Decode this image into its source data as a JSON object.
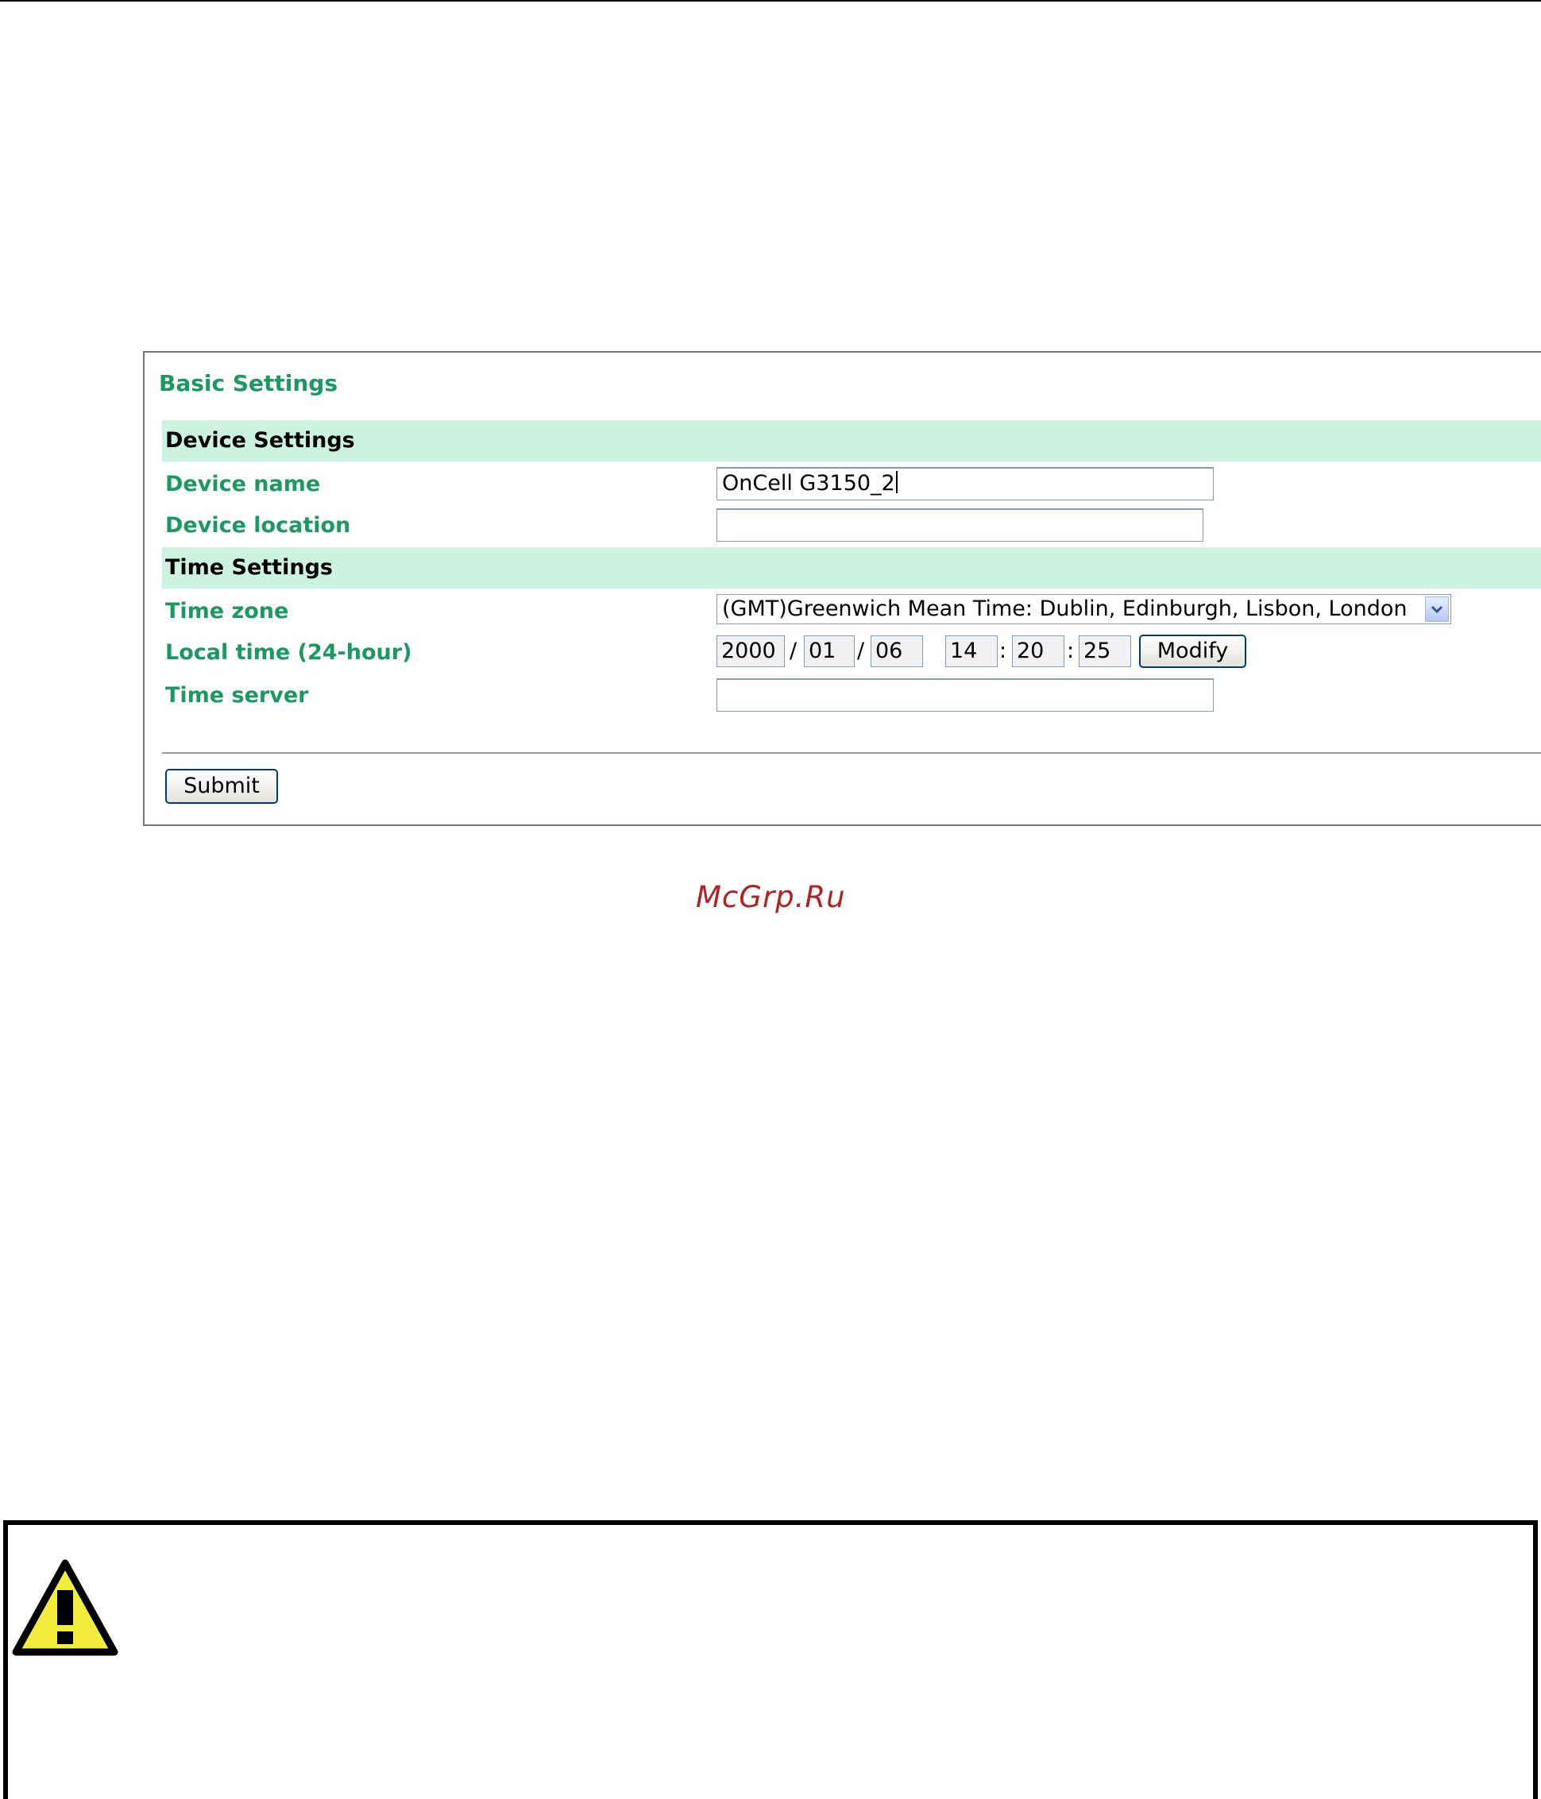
{
  "panel": {
    "title": "Basic Settings",
    "device_section": "Device Settings",
    "device_name_label": "Device name",
    "device_name_value": "OnCell G3150_2",
    "device_location_label": "Device location",
    "device_location_value": "",
    "time_section": "Time Settings",
    "time_zone_label": "Time zone",
    "time_zone_value": "(GMT)Greenwich Mean Time: Dublin, Edinburgh, Lisbon, London",
    "local_time_label": "Local time (24-hour)",
    "local_time": {
      "year": "2000",
      "month": "01",
      "day": "06",
      "hour": "14",
      "minute": "20",
      "second": "25",
      "date_sep": "/",
      "time_sep": ":"
    },
    "modify_label": "Modify",
    "time_server_label": "Time server",
    "time_server_value": "",
    "submit_label": "Submit"
  },
  "watermark": "McGrp.Ru",
  "colors": {
    "label_green": "#1a9960",
    "section_bg": "#ccf3df",
    "watermark_red": "#b22222",
    "warning_yellow": "#f2ed3c"
  },
  "icons": {
    "warning": "warning-triangle-icon",
    "dropdown": "chevron-down-icon"
  }
}
